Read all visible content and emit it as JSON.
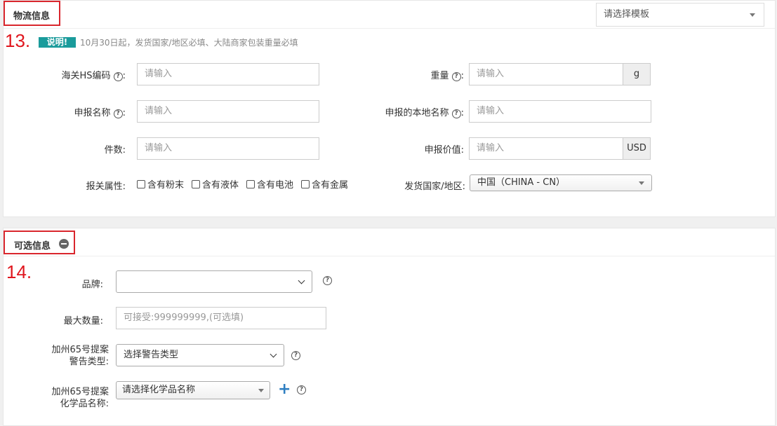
{
  "logistics": {
    "title": "物流信息",
    "template_placeholder": "请选择模板",
    "step_number": "13.",
    "notice_badge": "说明!",
    "notice_text": "10月30日起，发货国家/地区必填、大陆商家包装重量必填",
    "hs_code_label": "海关HS编码",
    "hs_code_placeholder": "请输入",
    "weight_label": "重量",
    "weight_placeholder": "请输入",
    "weight_unit": "g",
    "declare_name_label": "申报名称",
    "declare_name_placeholder": "请输入",
    "local_name_label": "申报的本地名称",
    "local_name_placeholder": "请输入",
    "quantity_label": "件数:",
    "quantity_placeholder": "请输入",
    "declare_value_label": "申报价值:",
    "declare_value_placeholder": "请输入",
    "declare_value_unit": "USD",
    "customs_attr_label": "报关属性:",
    "customs_attrs": [
      "含有粉末",
      "含有液体",
      "含有电池",
      "含有金属"
    ],
    "ship_country_label": "发货国家/地区:",
    "ship_country_value": "中国（CHINA - CN）",
    "colon": ":"
  },
  "optional": {
    "title": "可选信息",
    "step_number": "14.",
    "brand_label": "品牌:",
    "max_qty_label": "最大数量:",
    "max_qty_placeholder": "可接受:999999999,(可选填)",
    "prop65_warning_label_1": "加州65号提案",
    "prop65_warning_label_2": "警告类型:",
    "prop65_warning_value": "选择警告类型",
    "prop65_chem_label_1": "加州65号提案",
    "prop65_chem_label_2": "化学品名称:",
    "prop65_chem_value": "请选择化学品名称"
  },
  "colors": {
    "accent_red": "#d9262d",
    "badge_teal": "#1a9b9b",
    "plus_blue": "#2f7fc1"
  }
}
